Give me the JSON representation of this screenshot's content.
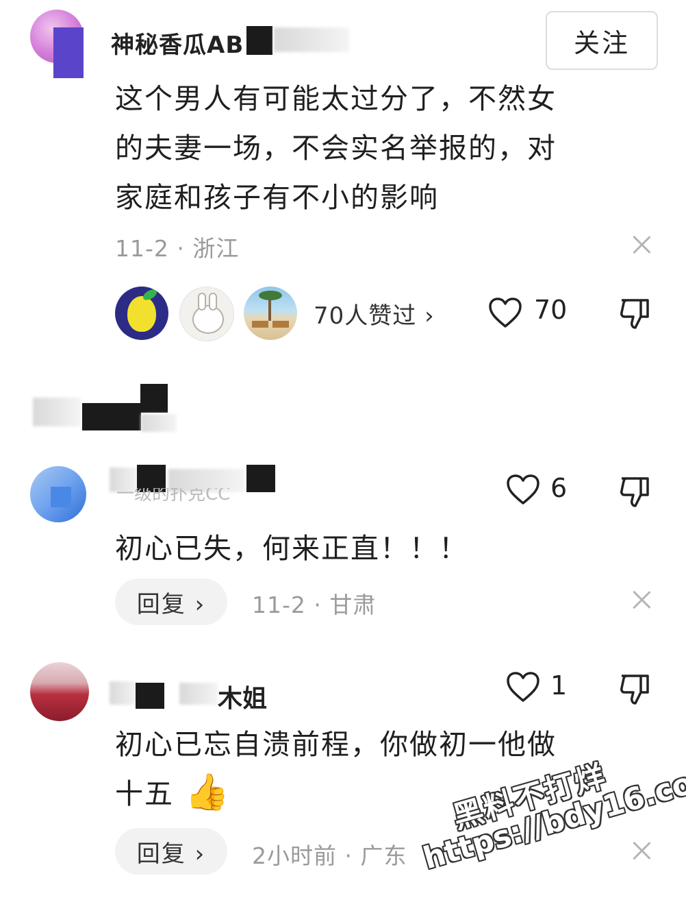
{
  "comment1": {
    "username": "神秘香瓜AB",
    "follow_label": "关注",
    "text_lines": [
      "这个男人有可能太过分了，不然女",
      "的夫妻一场，不会实名举报的，对",
      "家庭和孩子有不小的影响"
    ],
    "meta": "11-2 · 浙江",
    "likers_text": "70人赞过 ›",
    "like_count": "70"
  },
  "comment2": {
    "username": "一级的扑克CC",
    "like_count": "6",
    "text": "初心已失，何来正直！！！",
    "reply_label": "回复 ›",
    "meta": "11-2 · 甘肃"
  },
  "comment3": {
    "username": "木姐",
    "like_count": "1",
    "text_lines": [
      "初心已忘自溃前程，你做初一他做",
      "十五"
    ],
    "emoji": "👍",
    "reply_label": "回复 ›",
    "meta": "2小时前 · 广东"
  },
  "watermark": {
    "line1": "黑料不打烊",
    "line2": "https://bdy16.co"
  },
  "colors": {
    "text": "#1f1f1f",
    "meta": "#9a9a9a",
    "reply_bg": "#f2f2f2",
    "avatar1": "#8a3fa0",
    "avatar2": "#3a7fd9",
    "avatar3": "#b23040"
  }
}
